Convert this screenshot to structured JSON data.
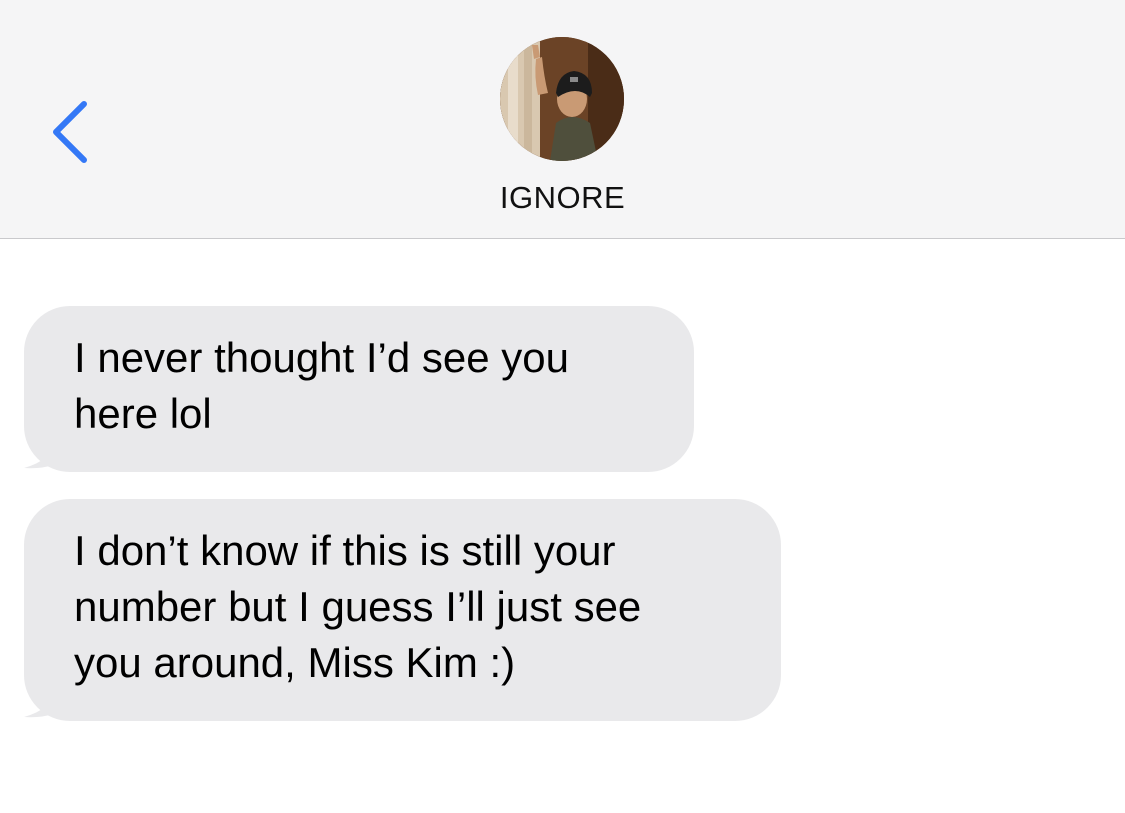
{
  "header": {
    "contact_name": "IGNORE",
    "back_icon": "chevron-left-icon",
    "accent_color": "#3478f6"
  },
  "messages": [
    {
      "direction": "incoming",
      "lines": [
        "I never thought I’d see you",
        "here lol"
      ]
    },
    {
      "direction": "incoming",
      "lines": [
        "I don’t know if this is still your",
        "number but I guess I’ll just see",
        "you around, Miss Kim :)"
      ]
    }
  ],
  "colors": {
    "header_bg": "#f5f5f6",
    "incoming_bubble": "#e9e9eb",
    "text": "#000000"
  }
}
